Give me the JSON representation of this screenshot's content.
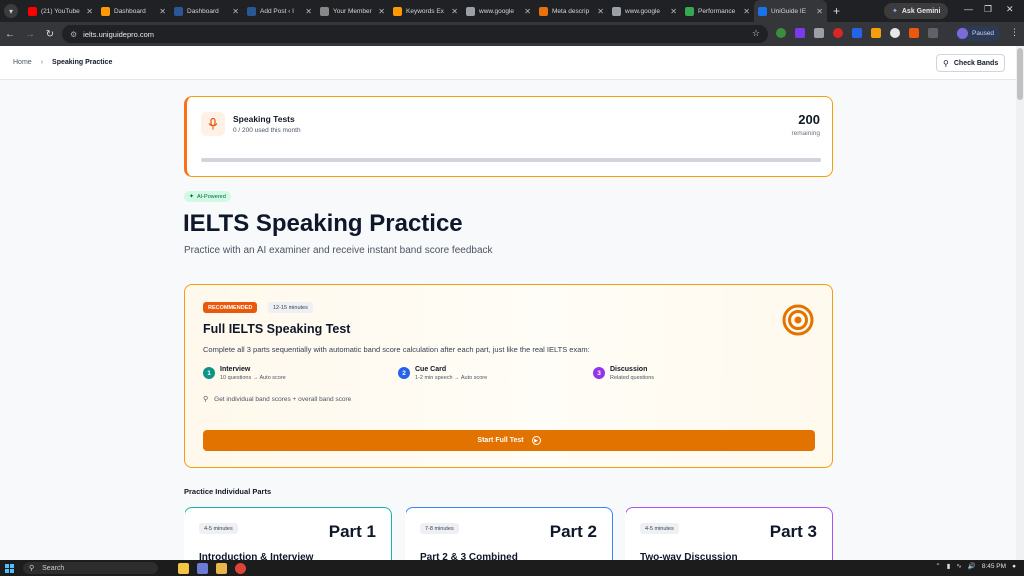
{
  "browser": {
    "tabs": [
      {
        "title": "(21) YouTube",
        "color": "#ff0000"
      },
      {
        "title": "Dashboard",
        "color": "#ff9900"
      },
      {
        "title": "Dashboard",
        "color": "#2b5797"
      },
      {
        "title": "Add Post ‹ I",
        "color": "#2b5797"
      },
      {
        "title": "Your Member",
        "color": "#888888"
      },
      {
        "title": "Keywords Ex",
        "color": "#ff9900"
      },
      {
        "title": "www.google",
        "color": "#9aa0a6"
      },
      {
        "title": "Meta descrip",
        "color": "#e8710a"
      },
      {
        "title": "www.google",
        "color": "#9aa0a6"
      },
      {
        "title": "Performance",
        "color": "#34a853"
      },
      {
        "title": "UniGuide IE",
        "color": "#1a73e8"
      }
    ],
    "ask_gemini": "Ask Gemini",
    "url": "ielts.uniguidepro.com",
    "profile_status": "Paused"
  },
  "page": {
    "breadcrumb": {
      "home": "Home",
      "current": "Speaking Practice"
    },
    "check_bands_label": "Check Bands",
    "usage": {
      "title": "Speaking Tests",
      "subtitle": "0 / 200 used this month",
      "count": "200",
      "count_label": "remaining",
      "used_fraction": 0
    },
    "badge": "AI-Powered",
    "heading": "IELTS Speaking Practice",
    "lead": "Practice with an AI examiner and receive instant band score feedback",
    "full_test": {
      "recommended_label": "RECOMMENDED",
      "duration": "12-15 minutes",
      "title": "Full IELTS Speaking Test",
      "description": "Complete all 3 parts sequentially with automatic band score calculation after each part, just like the real IELTS exam:",
      "steps": [
        {
          "num": "1",
          "title": "Interview",
          "desc": "10 questions → Auto score",
          "color": "#0d9488"
        },
        {
          "num": "2",
          "title": "Cue Card",
          "desc": "1-2 min speech → Auto score",
          "color": "#2563eb"
        },
        {
          "num": "3",
          "title": "Discussion",
          "desc": "Related questions",
          "color": "#9333ea"
        }
      ],
      "note": "Get individual band scores + overall band score",
      "start_label": "Start Full Test"
    },
    "section_title": "Practice Individual Parts",
    "parts": [
      {
        "duration": "4-5 minutes",
        "label": "Part 1",
        "name": "Introduction & Interview",
        "color": "#14b8a6"
      },
      {
        "duration": "7-8 minutes",
        "label": "Part 2",
        "name": "Part 2 & 3 Combined",
        "color": "#3b82f6"
      },
      {
        "duration": "4-5 minutes",
        "label": "Part 3",
        "name": "Two-way Discussion",
        "color": "#a855f7"
      }
    ]
  },
  "taskbar": {
    "search_placeholder": "Search",
    "time": "8:45 PM"
  }
}
